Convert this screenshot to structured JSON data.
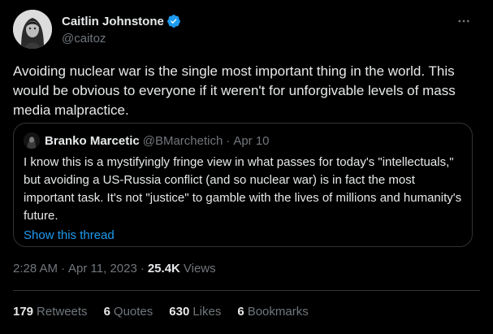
{
  "author": {
    "display_name": "Caitlin Johnstone",
    "handle": "@caitoz",
    "verified_color": "#1d9bf0"
  },
  "more_icon": "more-horizontal-icon",
  "tweet_text": "Avoiding nuclear war is the single most important thing in the world. This would be obvious to everyone if it weren't for unforgivable levels of mass media malpractice.",
  "quote": {
    "name": "Branko Marcetic",
    "handle": "@BMarchetich",
    "dot": "·",
    "date": "Apr 10",
    "text": "I know this is a mystifyingly fringe view in what passes for today's \"intellectuals,\" but avoiding a US-Russia conflict (and so nuclear war) is in fact the most important task. It's not \"justice\" to gamble with the lives of millions and humanity's future.",
    "show_thread": "Show this thread"
  },
  "meta": {
    "time": "2:28 AM",
    "dot": "·",
    "date": "Apr 11, 2023",
    "views_count": "25.4K",
    "views_label": "Views"
  },
  "stats": {
    "retweets_num": "179",
    "retweets_label": "Retweets",
    "quotes_num": "6",
    "quotes_label": "Quotes",
    "likes_num": "630",
    "likes_label": "Likes",
    "bookmarks_num": "6",
    "bookmarks_label": "Bookmarks"
  },
  "colors": {
    "background": "#000000",
    "text": "#e7e9ea",
    "secondary": "#71767b",
    "link": "#1d9bf0",
    "border": "#2f3336"
  }
}
